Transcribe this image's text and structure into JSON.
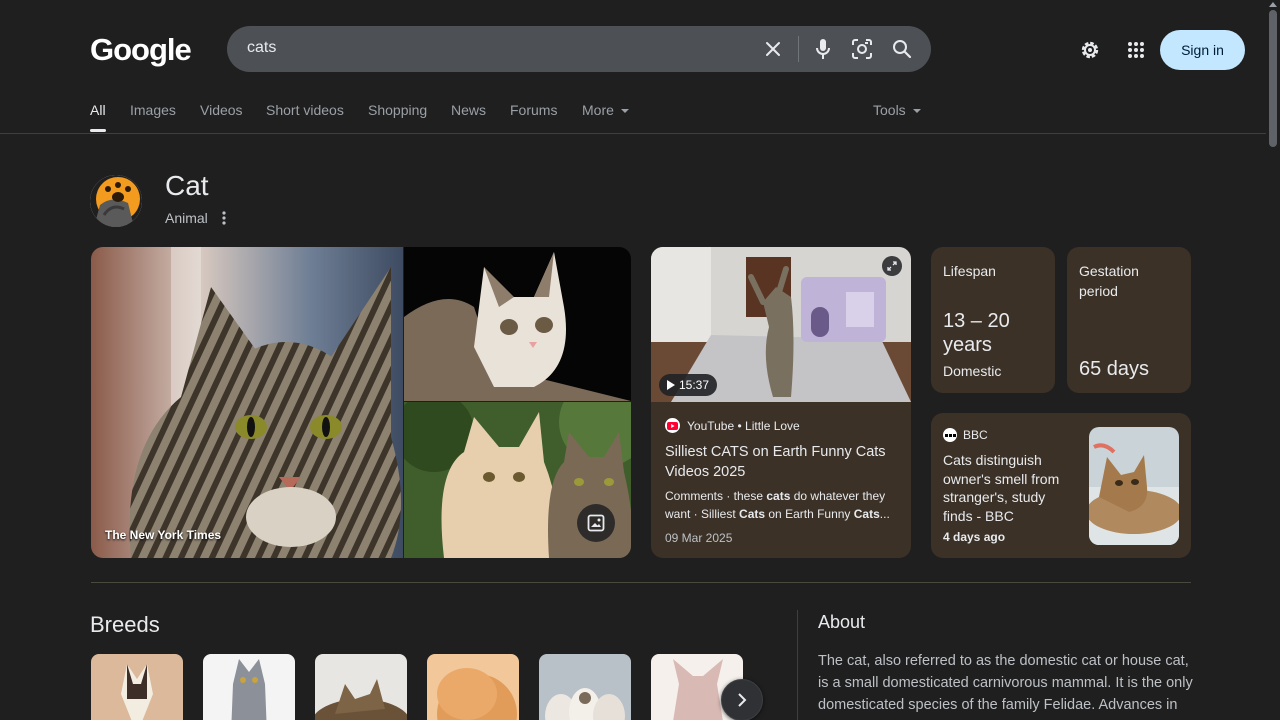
{
  "header": {
    "logo": "Google",
    "search_query": "cats",
    "sign_in_label": "Sign in"
  },
  "tabs": [
    {
      "label": "All",
      "active": true
    },
    {
      "label": "Images"
    },
    {
      "label": "Videos"
    },
    {
      "label": "Short videos"
    },
    {
      "label": "Shopping"
    },
    {
      "label": "News"
    },
    {
      "label": "Forums"
    },
    {
      "label": "More"
    },
    {
      "label": "Tools"
    }
  ],
  "entity": {
    "title": "Cat",
    "subtitle": "Animal"
  },
  "collage": {
    "credit": "The New York Times"
  },
  "video": {
    "duration": "15:37",
    "source": "YouTube • Little Love",
    "title": "Silliest CATS on Earth Funny Cats Videos 2025",
    "snippet_parts": [
      "Comments · these ",
      "cats",
      " do whatever they want · Silliest ",
      "Cats",
      " on Earth Funny ",
      "Cats",
      "..."
    ],
    "date": "09 Mar 2025"
  },
  "facts": {
    "lifespan": {
      "label": "Lifespan",
      "value": "13 – 20 years",
      "sub": "Domestic"
    },
    "gestation": {
      "label": "Gestation period",
      "value": "65 days"
    }
  },
  "news": {
    "source": "BBC",
    "title": "Cats distinguish owner's smell from stranger's, study finds - BBC",
    "time": "4 days ago"
  },
  "breeds": {
    "title": "Breeds"
  },
  "about": {
    "title": "About",
    "text": "The cat, also referred to as the domestic cat or house cat, is a small domesticated carnivorous mammal. It is the only domesticated species of the family Felidae. Advances in"
  },
  "colors": {
    "background": "#1f1f1f",
    "card": "#3b3127",
    "search_bar": "#4d5156",
    "sign_in_bg": "#c2e7ff",
    "text": "#e8eaed",
    "muted": "#9aa0a6"
  }
}
